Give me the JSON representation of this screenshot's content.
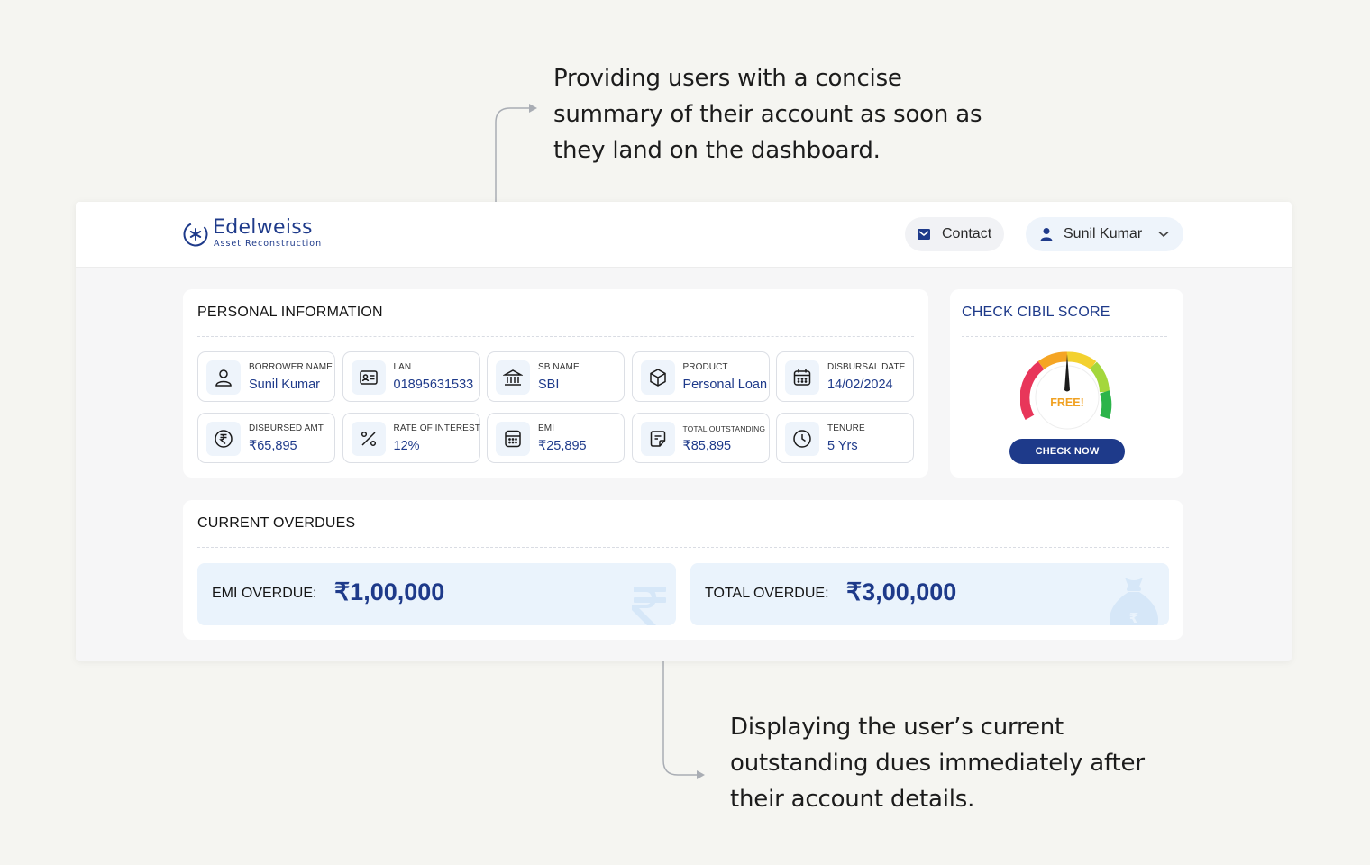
{
  "annotations": {
    "top": [
      "Providing users with a concise",
      "summary of their account as soon as",
      "they land on the dashboard."
    ],
    "bottom": [
      "Displaying the user’s current",
      "outstanding dues immediately after",
      "their account details."
    ]
  },
  "brand": {
    "name": "Edelweiss",
    "tagline": "Asset Reconstruction",
    "color": "#1e3a8a"
  },
  "header": {
    "contact_label": "Contact",
    "contact_icon": "mail-icon",
    "user_name": "Sunil Kumar",
    "user_icon": "user-icon"
  },
  "personal_info": {
    "title": "PERSONAL INFORMATION",
    "fields": [
      {
        "label": "BORROWER NAME",
        "value": "Sunil Kumar",
        "icon": "user-outline-icon"
      },
      {
        "label": "LAN",
        "value": "01895631533",
        "icon": "id-card-icon"
      },
      {
        "label": "SB NAME",
        "value": "SBI",
        "icon": "bank-icon"
      },
      {
        "label": "PRODUCT",
        "value": "Personal Loan",
        "icon": "box-icon"
      },
      {
        "label": "DISBURSAL DATE",
        "value": "14/02/2024",
        "icon": "calendar-icon"
      },
      {
        "label": "DISBURSED AMT",
        "value": "₹65,895",
        "icon": "rupee-circle-icon"
      },
      {
        "label": "RATE OF INTEREST",
        "value": "12%",
        "icon": "percent-icon"
      },
      {
        "label": "EMI",
        "value": "₹25,895",
        "icon": "calculator-icon"
      },
      {
        "label": "TOTAL OUTSTANDING",
        "value": "₹85,895",
        "icon": "note-icon"
      },
      {
        "label": "TENURE",
        "value": "5 Yrs",
        "icon": "clock-icon"
      }
    ]
  },
  "cibil": {
    "title": "CHECK CIBIL SCORE",
    "gauge_text": "FREE!",
    "button_label": "CHECK NOW",
    "gauge_colors": [
      "#e8365a",
      "#f5a524",
      "#f3d12f",
      "#a4d73c",
      "#2cb44a"
    ]
  },
  "overdues": {
    "title": "CURRENT OVERDUES",
    "emi_label": "EMI OVERDUE:",
    "emi_value": "₹1,00,000",
    "total_label": "TOTAL OVERDUE:",
    "total_value": "₹3,00,000"
  }
}
